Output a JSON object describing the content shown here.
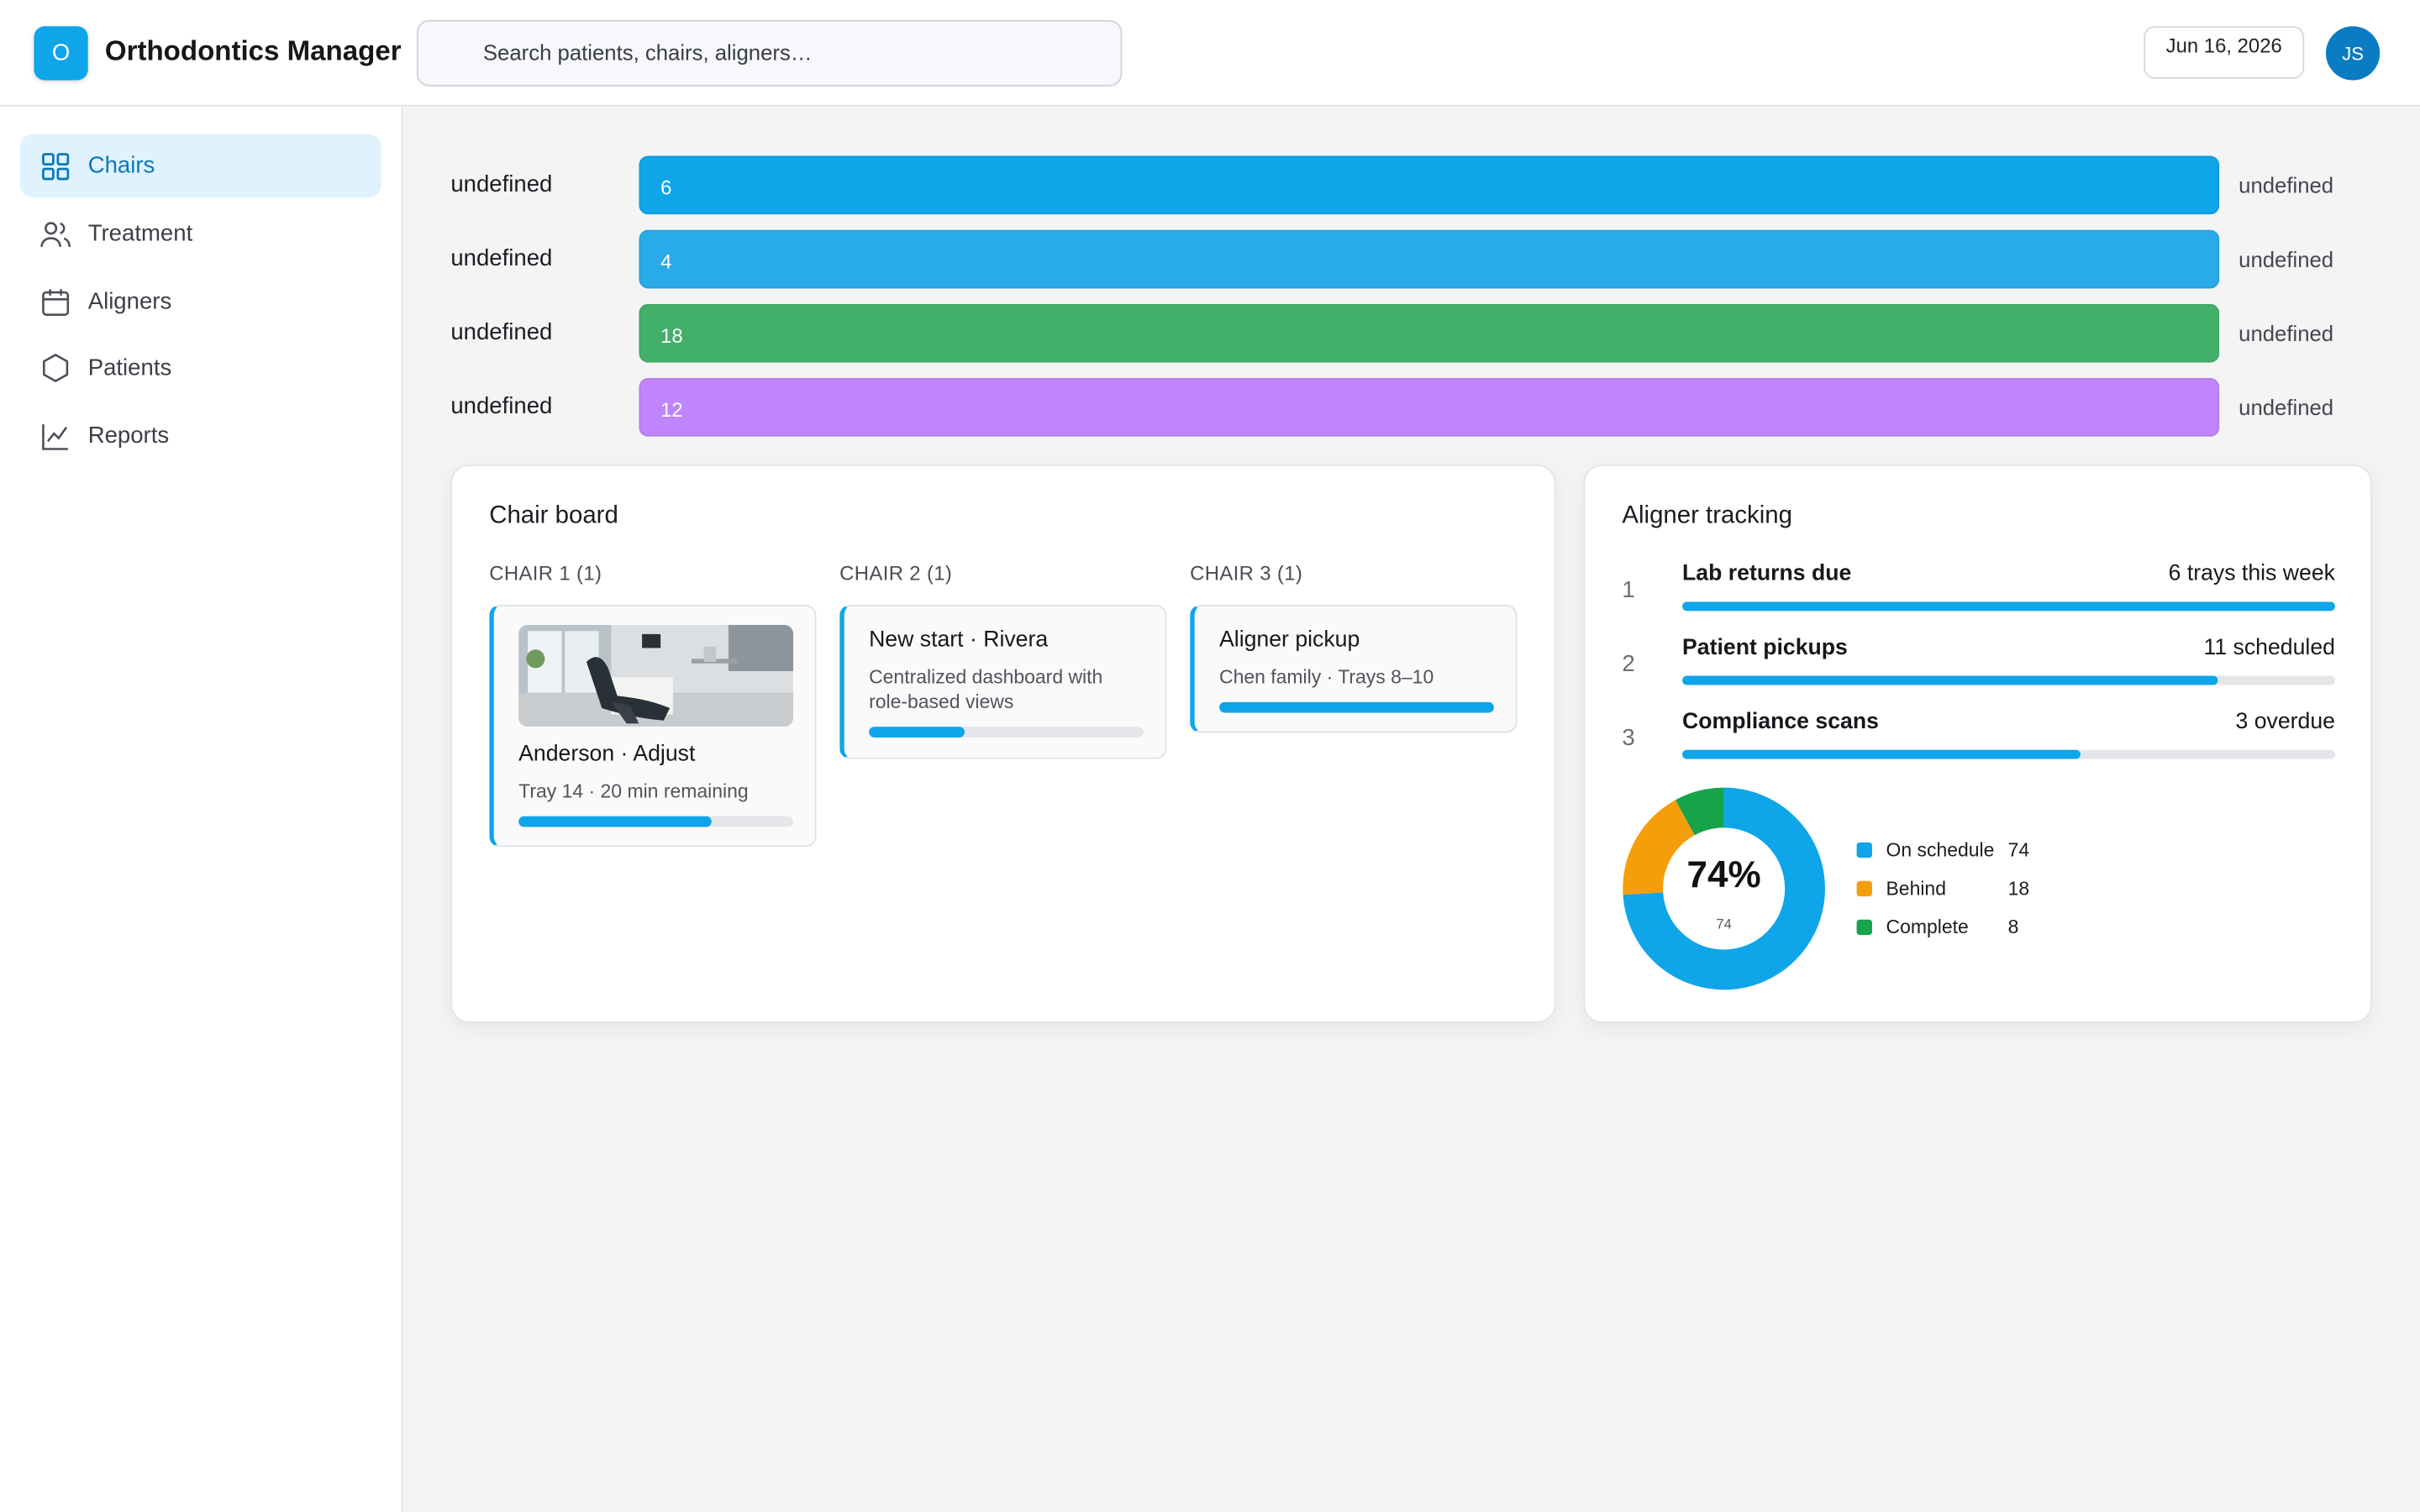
{
  "header": {
    "logo_letter": "O",
    "app_title": "Orthodontics Manager",
    "search_placeholder": "Search patients, chairs, aligners…",
    "date": "Jun 16, 2026",
    "avatar_initials": "JS"
  },
  "sidebar": {
    "items": [
      {
        "label": "Chairs",
        "icon": "grid-icon",
        "active": true
      },
      {
        "label": "Treatment",
        "icon": "users-icon",
        "active": false
      },
      {
        "label": "Aligners",
        "icon": "calendar-icon",
        "active": false
      },
      {
        "label": "Patients",
        "icon": "hexagon-icon",
        "active": false
      },
      {
        "label": "Reports",
        "icon": "line-chart-icon",
        "active": false
      }
    ]
  },
  "bars": [
    {
      "label": "undefined",
      "value": "6",
      "right": "undefined",
      "color": "#0ea5e9",
      "fill_fraction": 1.0
    },
    {
      "label": "undefined",
      "value": "4",
      "right": "undefined",
      "color": "#29aae9",
      "fill_fraction": 1.0
    },
    {
      "label": "undefined",
      "value": "18",
      "right": "undefined",
      "color": "#43b06a",
      "fill_fraction": 1.0
    },
    {
      "label": "undefined",
      "value": "12",
      "right": "undefined",
      "color": "#c084fc",
      "fill_fraction": 1.0
    }
  ],
  "chair_board": {
    "title": "Chair board",
    "columns": [
      {
        "header": "CHAIR 1 (1)",
        "card": {
          "title": "Anderson · Adjust",
          "sub": "Tray 14 · 20 min remaining",
          "progress": 0.7,
          "has_photo": true
        }
      },
      {
        "header": "CHAIR 2 (1)",
        "card": {
          "title": "New start · Rivera",
          "sub": "Centralized dashboard with role-based views",
          "progress": 0.35
        }
      },
      {
        "header": "CHAIR 3 (1)",
        "card": {
          "title": "Aligner pickup",
          "sub": "Chen family · Trays 8–10",
          "progress": 1.0
        }
      }
    ]
  },
  "aligner_tracking": {
    "title": "Aligner tracking",
    "rows": [
      {
        "num": "1",
        "name": "Lab returns due",
        "value": "6 trays this week",
        "progress": 1.0
      },
      {
        "num": "2",
        "name": "Patient pickups",
        "value": "11 scheduled",
        "progress": 0.82
      },
      {
        "num": "3",
        "name": "Compliance scans",
        "value": "3 overdue",
        "progress": 0.61
      }
    ],
    "donut": {
      "center_text": "74%",
      "sub_text": "74"
    },
    "legend": [
      {
        "name": "On schedule",
        "value": "74",
        "color": "#0ea5e9"
      },
      {
        "name": "Behind",
        "value": "18",
        "color": "#f59e0b"
      },
      {
        "name": "Complete",
        "value": "8",
        "color": "#16a34a"
      }
    ]
  }
}
